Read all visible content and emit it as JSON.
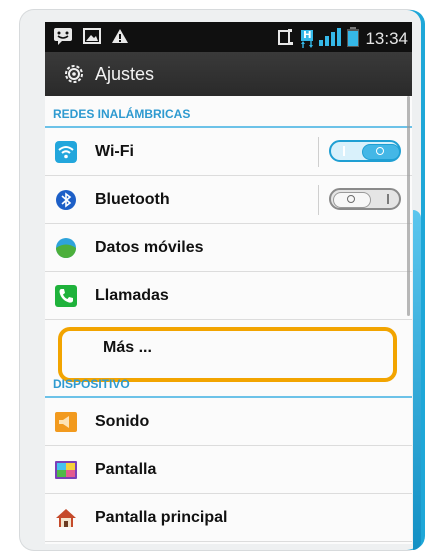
{
  "statusbar": {
    "icons_left": [
      "chat-icon",
      "image-icon",
      "warning-icon"
    ],
    "icons_right": [
      "sim-icon",
      "hspa-data-icon",
      "signal-icon",
      "battery-icon"
    ],
    "data_indicator": "H",
    "time": "13:34"
  },
  "titlebar": {
    "title": "Ajustes",
    "icon": "gear-icon"
  },
  "sections": {
    "wireless": "REDES INALÁMBRICAS",
    "device": "DISPOSITIVO"
  },
  "wireless_items": [
    {
      "label": "Wi-Fi",
      "icon": "wifi-icon",
      "toggle": "on"
    },
    {
      "label": "Bluetooth",
      "icon": "bluetooth-icon",
      "toggle": "off"
    },
    {
      "label": "Datos móviles",
      "icon": "mobile-data-icon"
    },
    {
      "label": "Llamadas",
      "icon": "phone-icon"
    },
    {
      "label": "Más ...",
      "icon": ""
    }
  ],
  "device_items": [
    {
      "label": "Sonido",
      "icon": "speaker-icon"
    },
    {
      "label": "Pantalla",
      "icon": "display-icon"
    },
    {
      "label": "Pantalla principal",
      "icon": "home-icon"
    }
  ],
  "colors": {
    "accent": "#2e9ad0",
    "highlight": "#f2a400",
    "statusbar": "#101010",
    "titlebar": "#2f2f2f"
  }
}
